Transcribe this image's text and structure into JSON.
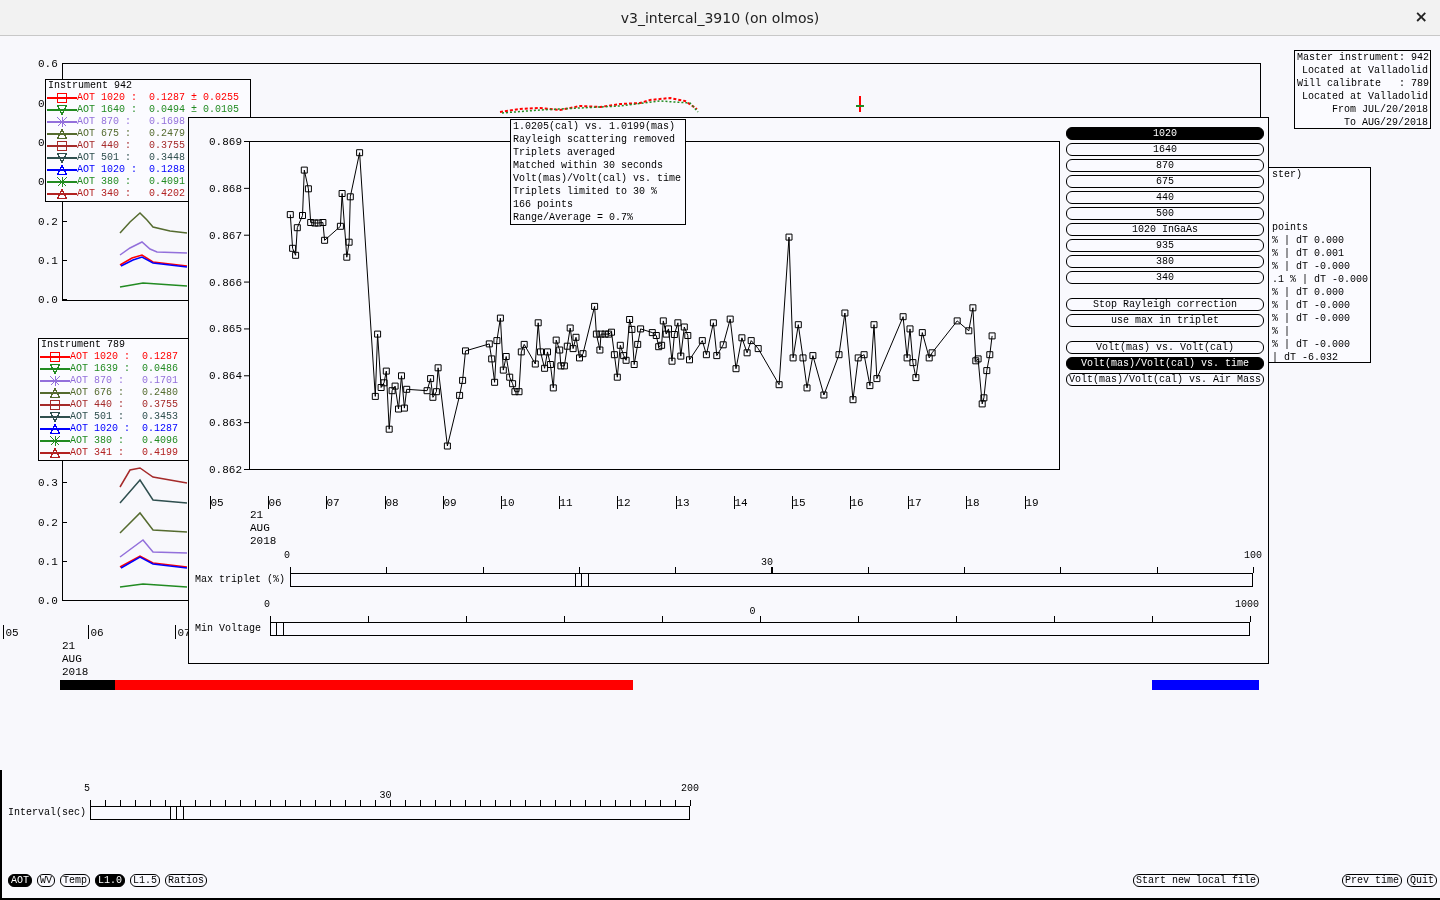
{
  "window": {
    "title": "v3_intercal_3910 (on olmos)",
    "close": "×"
  },
  "background_plots": [
    {
      "y_ticks": [
        "0.6",
        "0",
        "0",
        "0",
        "0.2",
        "0.1",
        "0.0"
      ]
    },
    {
      "y_ticks": [
        "0.3",
        "0.2",
        "0.1",
        "0.0"
      ],
      "x_ticks": [
        "05",
        "06",
        "07"
      ],
      "date": [
        "21",
        "AUG",
        "2018"
      ]
    }
  ],
  "legends": [
    {
      "title": "Instrument 942",
      "items": [
        {
          "label": "AOT 1020 :",
          "value": "0.1287 ± 0.0255",
          "color": "#ff0000",
          "kind": "square"
        },
        {
          "label": "AOT 1640 :",
          "value": "0.0494 ± 0.0105",
          "color": "#228b22",
          "kind": "down"
        },
        {
          "label": "AOT 870 :",
          "value": "0.1698",
          "color": "#9370db",
          "kind": "cross"
        },
        {
          "label": "AOT 675 :",
          "value": "0.2479",
          "color": "#556b2f",
          "kind": "up"
        },
        {
          "label": "AOT 440 :",
          "value": "0.3755",
          "color": "#a52a2a",
          "kind": "square"
        },
        {
          "label": "AOT 501 :",
          "value": "0.3448",
          "color": "#2f4f4f",
          "kind": "down"
        },
        {
          "label": "AOT 1020 :",
          "value": "0.1288",
          "color": "#0000ff",
          "kind": "up"
        },
        {
          "label": "AOT 380 :",
          "value": "0.4091",
          "color": "#228b22",
          "kind": "cross"
        },
        {
          "label": "AOT 340 :",
          "value": "0.4202",
          "color": "#b22222",
          "kind": "up"
        }
      ]
    },
    {
      "title": "Instrument 789",
      "items": [
        {
          "label": "AOT 1020 :",
          "value": "0.1287",
          "color": "#ff0000",
          "kind": "square"
        },
        {
          "label": "AOT 1639 :",
          "value": "0.0486",
          "color": "#228b22",
          "kind": "down"
        },
        {
          "label": "AOT 870 :",
          "value": "0.1701",
          "color": "#9370db",
          "kind": "cross"
        },
        {
          "label": "AOT 676 :",
          "value": "0.2480",
          "color": "#556b2f",
          "kind": "up"
        },
        {
          "label": "AOT 440 :",
          "value": "0.3755",
          "color": "#a52a2a",
          "kind": "square"
        },
        {
          "label": "AOT 501 :",
          "value": "0.3453",
          "color": "#2f4f4f",
          "kind": "down"
        },
        {
          "label": "AOT 1020 :",
          "value": "0.1287",
          "color": "#0000ff",
          "kind": "up"
        },
        {
          "label": "AOT 380 :",
          "value": "0.4096",
          "color": "#228b22",
          "kind": "cross"
        },
        {
          "label": "AOT 341 :",
          "value": "0.4199",
          "color": "#b22222",
          "kind": "up"
        }
      ]
    }
  ],
  "master_info": [
    "Master instrument: 942",
    "Located at Valladolid",
    "Will calibrate   : 789",
    "Located at Valladolid",
    "From JUL/20/2018",
    "To AUG/29/2018"
  ],
  "stats_panel": {
    "heading": "ster)",
    "lines": [
      "points",
      "% | dT 0.000",
      "% | dT 0.001",
      "% | dT -0.000",
      ".1 % | dT -0.000",
      "% | dT 0.000",
      "% | dT -0.000",
      "% | dT -0.000",
      "% |",
      "% | dT -0.000",
      "| dT -6.032"
    ]
  },
  "ratio_window": {
    "x_start_label": "05",
    "chart_data": {
      "type": "line",
      "xlim": [
        5.55,
        19.47
      ],
      "ylim": [
        0.862,
        0.869
      ],
      "yticks": [
        0.862,
        0.863,
        0.864,
        0.865,
        0.866,
        0.867,
        0.868,
        0.869
      ],
      "xticks": [
        {
          "value": 6,
          "label": "06"
        },
        {
          "value": 7,
          "label": "07"
        },
        {
          "value": 8,
          "label": "08"
        },
        {
          "value": 9,
          "label": "09"
        },
        {
          "value": 10,
          "label": "10"
        },
        {
          "value": 11,
          "label": "11"
        },
        {
          "value": 12,
          "label": "12"
        },
        {
          "value": 13,
          "label": "13"
        },
        {
          "value": 14,
          "label": "14"
        },
        {
          "value": 15,
          "label": "15"
        },
        {
          "value": 16,
          "label": "16"
        },
        {
          "value": 17,
          "label": "17"
        },
        {
          "value": 18,
          "label": "18"
        },
        {
          "value": 19,
          "label": "19"
        }
      ],
      "x": [
        6.26,
        6.3,
        6.35,
        6.38,
        6.47,
        6.5,
        6.57,
        6.61,
        6.68,
        6.74,
        6.82,
        6.85,
        7.12,
        7.15,
        7.23,
        7.27,
        7.29,
        7.45,
        7.72,
        7.76,
        7.82,
        7.87,
        7.91,
        7.96,
        8.01,
        8.06,
        8.12,
        8.17,
        8.22,
        8.26,
        8.61,
        8.67,
        8.71,
        8.77,
        8.8,
        8.96,
        9.17,
        9.22,
        9.27,
        9.68,
        9.72,
        9.77,
        9.81,
        9.87,
        9.92,
        9.97,
        10.03,
        10.08,
        10.12,
        10.19,
        10.23,
        10.28,
        10.47,
        10.52,
        10.56,
        10.63,
        10.68,
        10.73,
        10.78,
        10.83,
        10.89,
        10.91,
        10.97,
        11.02,
        11.07,
        11.12,
        11.17,
        11.23,
        11.29,
        11.49,
        11.52,
        11.58,
        11.6,
        11.67,
        11.73,
        11.78,
        11.83,
        11.88,
        11.93,
        11.99,
        12.03,
        12.09,
        12.13,
        12.17,
        12.23,
        12.28,
        12.48,
        12.55,
        12.59,
        12.64,
        12.67,
        12.72,
        12.76,
        12.82,
        12.86,
        12.92,
        12.97,
        13.03,
        13.09,
        13.12,
        13.34,
        13.41,
        13.53,
        13.59,
        13.7,
        13.82,
        13.92,
        14.02,
        14.11,
        14.18,
        14.3,
        14.66,
        14.83,
        14.9,
        14.99,
        15.07,
        15.14,
        15.24,
        15.43,
        15.69,
        15.79,
        15.93,
        16.02,
        16.12,
        16.22,
        16.29,
        16.34,
        16.79,
        16.86,
        16.91,
        16.96,
        17.01,
        17.12,
        17.24,
        17.29,
        17.72,
        17.92,
        17.99,
        18.04,
        18.08,
        18.15,
        18.18,
        18.23,
        18.28,
        18.32
      ],
      "series": [
        {
          "color": "#000000",
          "marker": "square",
          "values": [
            0.86743,
            0.86671,
            0.86656,
            0.86715,
            0.86741,
            0.86838,
            0.86798,
            0.86726,
            0.86725,
            0.86725,
            0.86726,
            0.86688,
            0.86718,
            0.86788,
            0.86652,
            0.86684,
            0.86781,
            0.86875,
            0.86355,
            0.86488,
            0.86374,
            0.86384,
            0.86409,
            0.86285,
            0.86367,
            0.86377,
            0.86328,
            0.86399,
            0.8633,
            0.8637,
            0.86367,
            0.86393,
            0.86353,
            0.86365,
            0.86416,
            0.86249,
            0.86357,
            0.86389,
            0.86452,
            0.86467,
            0.86435,
            0.86385,
            0.86474,
            0.86522,
            0.86411,
            0.8644,
            0.86396,
            0.86382,
            0.86365,
            0.86365,
            0.8645,
            0.86466,
            0.86424,
            0.86512,
            0.8645,
            0.86415,
            0.8645,
            0.86423,
            0.86373,
            0.86475,
            0.86454,
            0.8642,
            0.8642,
            0.86462,
            0.86501,
            0.86457,
            0.86481,
            0.86437,
            0.86446,
            0.86547,
            0.86488,
            0.86454,
            0.86488,
            0.86488,
            0.86488,
            0.86492,
            0.86444,
            0.86396,
            0.86464,
            0.86442,
            0.86432,
            0.86519,
            0.86498,
            0.86423,
            0.86466,
            0.86499,
            0.86491,
            0.86485,
            0.86461,
            0.86464,
            0.86516,
            0.86488,
            0.86499,
            0.8643,
            0.86487,
            0.86512,
            0.86441,
            0.86503,
            0.86485,
            0.86433,
            0.86474,
            0.86444,
            0.86512,
            0.86442,
            0.86465,
            0.8652,
            0.86414,
            0.8648,
            0.86448,
            0.86474,
            0.86457,
            0.8638,
            0.86695,
            0.86437,
            0.86508,
            0.86437,
            0.86373,
            0.86442,
            0.86358,
            0.86444,
            0.86533,
            0.86348,
            0.86437,
            0.86444,
            0.86378,
            0.86508,
            0.86393,
            0.86525,
            0.86437,
            0.86499,
            0.86427,
            0.86395,
            0.86491,
            0.86437,
            0.86448,
            0.86516,
            0.86495,
            0.86544,
            0.86431,
            0.86435,
            0.86339,
            0.86352,
            0.8641,
            0.86444,
            0.86484
          ]
        }
      ]
    },
    "date_label": [
      "21",
      "AUG",
      "2018"
    ],
    "info": [
      "1.0205(cal) vs. 1.0199(mas)",
      "Rayleigh scattering removed",
      "Triplets averaged",
      "Matched within 30 seconds",
      "Volt(mas)/Volt(cal) vs. time",
      "Triplets limited to 30 %",
      "166 points",
      "Range/Average = 0.7%"
    ],
    "wavelengths": [
      {
        "label": "1020",
        "selected": true
      },
      {
        "label": "1640",
        "selected": false
      },
      {
        "label": "870",
        "selected": false
      },
      {
        "label": "675",
        "selected": false
      },
      {
        "label": "440",
        "selected": false
      },
      {
        "label": "500",
        "selected": false
      },
      {
        "label": "1020 InGaAs",
        "selected": false
      },
      {
        "label": "935",
        "selected": false
      },
      {
        "label": "380",
        "selected": false
      },
      {
        "label": "340",
        "selected": false
      }
    ],
    "options": [
      "Stop Rayleigh correction",
      "use max in triplet"
    ],
    "plot_modes": [
      {
        "label": "Volt(mas) vs. Volt(cal)",
        "selected": false
      },
      {
        "label": "Volt(mas)/Volt(cal) vs. time",
        "selected": true
      },
      {
        "label": "Volt(mas)/Volt(cal) vs. Air Mass",
        "selected": false
      }
    ],
    "sliders": [
      {
        "label": "Max triplet (%)",
        "min": "0",
        "mid": "30",
        "max": "100",
        "level": 0.3
      },
      {
        "label": "Min Voltage",
        "min": "0",
        "mid": "0",
        "max": "1000",
        "level": 0.0
      }
    ]
  },
  "controls": {
    "interval_slider": {
      "label": "Interval(sec)",
      "min": "5",
      "mid": "30",
      "max": "200",
      "level": 0.137
    },
    "data_buttons": [
      {
        "label": "AOT",
        "selected": true
      },
      {
        "label": "WV",
        "selected": false
      },
      {
        "label": "Temp",
        "selected": false
      },
      {
        "label": "L1.0",
        "selected": true
      },
      {
        "label": "L1.5",
        "selected": false
      },
      {
        "label": "Ratios",
        "selected": false
      }
    ],
    "file_button": "Start new local file",
    "nav_buttons": [
      "Prev time",
      "Quit"
    ]
  }
}
